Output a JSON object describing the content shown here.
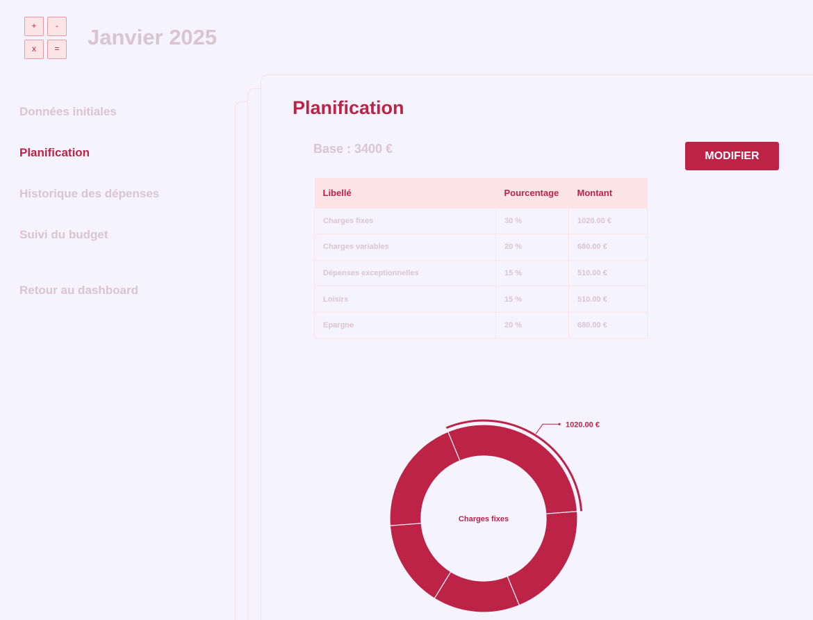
{
  "header": {
    "title": "Janvier 2025",
    "logo_keys": [
      "+",
      "-",
      "x",
      "="
    ]
  },
  "sidebar": {
    "items": [
      {
        "label": "Données initiales",
        "active": false
      },
      {
        "label": "Planification",
        "active": true
      },
      {
        "label": "Historique des dépenses",
        "active": false
      },
      {
        "label": "Suivi du budget",
        "active": false
      },
      {
        "label": "Retour au dashboard",
        "active": false
      }
    ]
  },
  "main": {
    "title": "Planification",
    "base_label": "Base : 3400 €",
    "modify_label": "MODIFIER"
  },
  "table": {
    "headers": [
      "Libellé",
      "Pourcentage",
      "Montant"
    ],
    "rows": [
      [
        "Charges fixes",
        "30 %",
        "1020.00 €"
      ],
      [
        "Charges variables",
        "20 %",
        "680.00 €"
      ],
      [
        "Dépenses exceptionnelles",
        "15 %",
        "510.00 €"
      ],
      [
        "Loisirs",
        "15 %",
        "510.00 €"
      ],
      [
        "Epargne",
        "20 %",
        "680.00 €"
      ]
    ]
  },
  "colors": {
    "accent": "#bd2346",
    "muted_text": "#d9c5d2",
    "header_bg": "#fde5e6",
    "page_bg": "#f4f3fe"
  },
  "chart_data": {
    "type": "pie",
    "categories": [
      "Charges fixes",
      "Charges variables",
      "Dépenses exceptionnelles",
      "Loisirs",
      "Epargne"
    ],
    "values": [
      1020,
      680,
      510,
      510,
      680
    ],
    "highlighted": "Charges fixes",
    "center_label": "Charges fixes",
    "highlight_value_label": "1020.00 €"
  }
}
